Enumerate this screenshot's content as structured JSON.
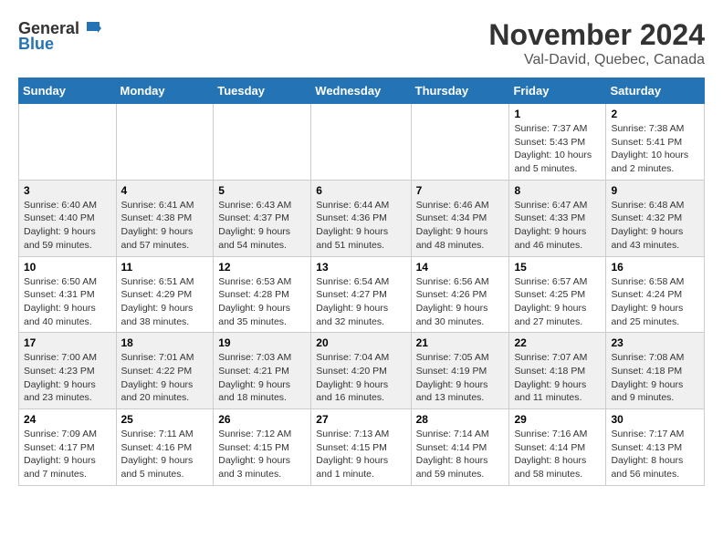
{
  "header": {
    "logo_general": "General",
    "logo_blue": "Blue",
    "month_title": "November 2024",
    "location": "Val-David, Quebec, Canada"
  },
  "weekdays": [
    "Sunday",
    "Monday",
    "Tuesday",
    "Wednesday",
    "Thursday",
    "Friday",
    "Saturday"
  ],
  "weeks": [
    [
      {
        "day": "",
        "sunrise": "",
        "sunset": "",
        "daylight": ""
      },
      {
        "day": "",
        "sunrise": "",
        "sunset": "",
        "daylight": ""
      },
      {
        "day": "",
        "sunrise": "",
        "sunset": "",
        "daylight": ""
      },
      {
        "day": "",
        "sunrise": "",
        "sunset": "",
        "daylight": ""
      },
      {
        "day": "",
        "sunrise": "",
        "sunset": "",
        "daylight": ""
      },
      {
        "day": "1",
        "sunrise": "Sunrise: 7:37 AM",
        "sunset": "Sunset: 5:43 PM",
        "daylight": "Daylight: 10 hours and 5 minutes."
      },
      {
        "day": "2",
        "sunrise": "Sunrise: 7:38 AM",
        "sunset": "Sunset: 5:41 PM",
        "daylight": "Daylight: 10 hours and 2 minutes."
      }
    ],
    [
      {
        "day": "3",
        "sunrise": "Sunrise: 6:40 AM",
        "sunset": "Sunset: 4:40 PM",
        "daylight": "Daylight: 9 hours and 59 minutes."
      },
      {
        "day": "4",
        "sunrise": "Sunrise: 6:41 AM",
        "sunset": "Sunset: 4:38 PM",
        "daylight": "Daylight: 9 hours and 57 minutes."
      },
      {
        "day": "5",
        "sunrise": "Sunrise: 6:43 AM",
        "sunset": "Sunset: 4:37 PM",
        "daylight": "Daylight: 9 hours and 54 minutes."
      },
      {
        "day": "6",
        "sunrise": "Sunrise: 6:44 AM",
        "sunset": "Sunset: 4:36 PM",
        "daylight": "Daylight: 9 hours and 51 minutes."
      },
      {
        "day": "7",
        "sunrise": "Sunrise: 6:46 AM",
        "sunset": "Sunset: 4:34 PM",
        "daylight": "Daylight: 9 hours and 48 minutes."
      },
      {
        "day": "8",
        "sunrise": "Sunrise: 6:47 AM",
        "sunset": "Sunset: 4:33 PM",
        "daylight": "Daylight: 9 hours and 46 minutes."
      },
      {
        "day": "9",
        "sunrise": "Sunrise: 6:48 AM",
        "sunset": "Sunset: 4:32 PM",
        "daylight": "Daylight: 9 hours and 43 minutes."
      }
    ],
    [
      {
        "day": "10",
        "sunrise": "Sunrise: 6:50 AM",
        "sunset": "Sunset: 4:31 PM",
        "daylight": "Daylight: 9 hours and 40 minutes."
      },
      {
        "day": "11",
        "sunrise": "Sunrise: 6:51 AM",
        "sunset": "Sunset: 4:29 PM",
        "daylight": "Daylight: 9 hours and 38 minutes."
      },
      {
        "day": "12",
        "sunrise": "Sunrise: 6:53 AM",
        "sunset": "Sunset: 4:28 PM",
        "daylight": "Daylight: 9 hours and 35 minutes."
      },
      {
        "day": "13",
        "sunrise": "Sunrise: 6:54 AM",
        "sunset": "Sunset: 4:27 PM",
        "daylight": "Daylight: 9 hours and 32 minutes."
      },
      {
        "day": "14",
        "sunrise": "Sunrise: 6:56 AM",
        "sunset": "Sunset: 4:26 PM",
        "daylight": "Daylight: 9 hours and 30 minutes."
      },
      {
        "day": "15",
        "sunrise": "Sunrise: 6:57 AM",
        "sunset": "Sunset: 4:25 PM",
        "daylight": "Daylight: 9 hours and 27 minutes."
      },
      {
        "day": "16",
        "sunrise": "Sunrise: 6:58 AM",
        "sunset": "Sunset: 4:24 PM",
        "daylight": "Daylight: 9 hours and 25 minutes."
      }
    ],
    [
      {
        "day": "17",
        "sunrise": "Sunrise: 7:00 AM",
        "sunset": "Sunset: 4:23 PM",
        "daylight": "Daylight: 9 hours and 23 minutes."
      },
      {
        "day": "18",
        "sunrise": "Sunrise: 7:01 AM",
        "sunset": "Sunset: 4:22 PM",
        "daylight": "Daylight: 9 hours and 20 minutes."
      },
      {
        "day": "19",
        "sunrise": "Sunrise: 7:03 AM",
        "sunset": "Sunset: 4:21 PM",
        "daylight": "Daylight: 9 hours and 18 minutes."
      },
      {
        "day": "20",
        "sunrise": "Sunrise: 7:04 AM",
        "sunset": "Sunset: 4:20 PM",
        "daylight": "Daylight: 9 hours and 16 minutes."
      },
      {
        "day": "21",
        "sunrise": "Sunrise: 7:05 AM",
        "sunset": "Sunset: 4:19 PM",
        "daylight": "Daylight: 9 hours and 13 minutes."
      },
      {
        "day": "22",
        "sunrise": "Sunrise: 7:07 AM",
        "sunset": "Sunset: 4:18 PM",
        "daylight": "Daylight: 9 hours and 11 minutes."
      },
      {
        "day": "23",
        "sunrise": "Sunrise: 7:08 AM",
        "sunset": "Sunset: 4:18 PM",
        "daylight": "Daylight: 9 hours and 9 minutes."
      }
    ],
    [
      {
        "day": "24",
        "sunrise": "Sunrise: 7:09 AM",
        "sunset": "Sunset: 4:17 PM",
        "daylight": "Daylight: 9 hours and 7 minutes."
      },
      {
        "day": "25",
        "sunrise": "Sunrise: 7:11 AM",
        "sunset": "Sunset: 4:16 PM",
        "daylight": "Daylight: 9 hours and 5 minutes."
      },
      {
        "day": "26",
        "sunrise": "Sunrise: 7:12 AM",
        "sunset": "Sunset: 4:15 PM",
        "daylight": "Daylight: 9 hours and 3 minutes."
      },
      {
        "day": "27",
        "sunrise": "Sunrise: 7:13 AM",
        "sunset": "Sunset: 4:15 PM",
        "daylight": "Daylight: 9 hours and 1 minute."
      },
      {
        "day": "28",
        "sunrise": "Sunrise: 7:14 AM",
        "sunset": "Sunset: 4:14 PM",
        "daylight": "Daylight: 8 hours and 59 minutes."
      },
      {
        "day": "29",
        "sunrise": "Sunrise: 7:16 AM",
        "sunset": "Sunset: 4:14 PM",
        "daylight": "Daylight: 8 hours and 58 minutes."
      },
      {
        "day": "30",
        "sunrise": "Sunrise: 7:17 AM",
        "sunset": "Sunset: 4:13 PM",
        "daylight": "Daylight: 8 hours and 56 minutes."
      }
    ]
  ]
}
